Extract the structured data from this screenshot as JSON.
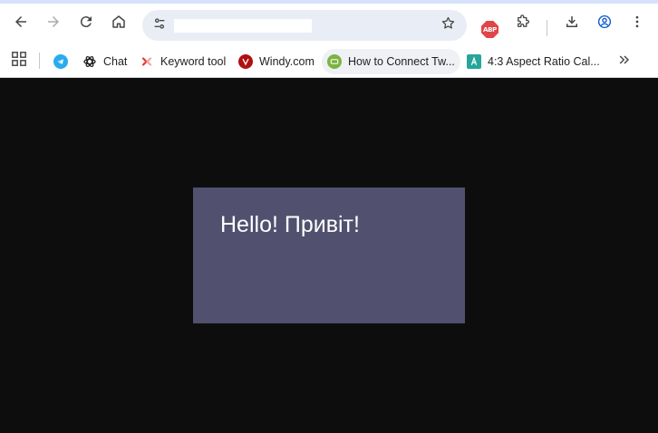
{
  "browser": {
    "address_bar": {
      "value": "",
      "placeholder": ""
    },
    "extensions": {
      "adblock_label": "ABP"
    },
    "icons": {
      "back": "arrow-left-icon",
      "forward": "arrow-right-icon",
      "reload": "reload-icon",
      "home": "home-icon",
      "site_info": "tune-icon",
      "bookmark": "star-icon",
      "extensions": "puzzle-icon",
      "downloads": "download-icon",
      "profile": "profile-icon",
      "menu": "kebab-menu-icon"
    }
  },
  "bookmarks": {
    "items": [
      {
        "label": "",
        "icon": "telegram-icon",
        "color": "#2aabee"
      },
      {
        "label": "Chat",
        "icon": "openai-icon",
        "color": "#202123"
      },
      {
        "label": "Keyword tool",
        "icon": "keyword-tool-icon",
        "color": "#e53935"
      },
      {
        "label": "Windy.com",
        "icon": "windy-icon",
        "color": "#b01010"
      },
      {
        "label": "How to Connect Tw...",
        "icon": "site-favicon-icon",
        "color": "#7cb342"
      },
      {
        "label": "4:3 Aspect Ratio Cal...",
        "icon": "aspect-ratio-icon",
        "color": "#26a69a"
      }
    ]
  },
  "page": {
    "greeting": "Hello! Привіт!",
    "card_color": "#51506e",
    "background_color": "#0d0d0e"
  }
}
